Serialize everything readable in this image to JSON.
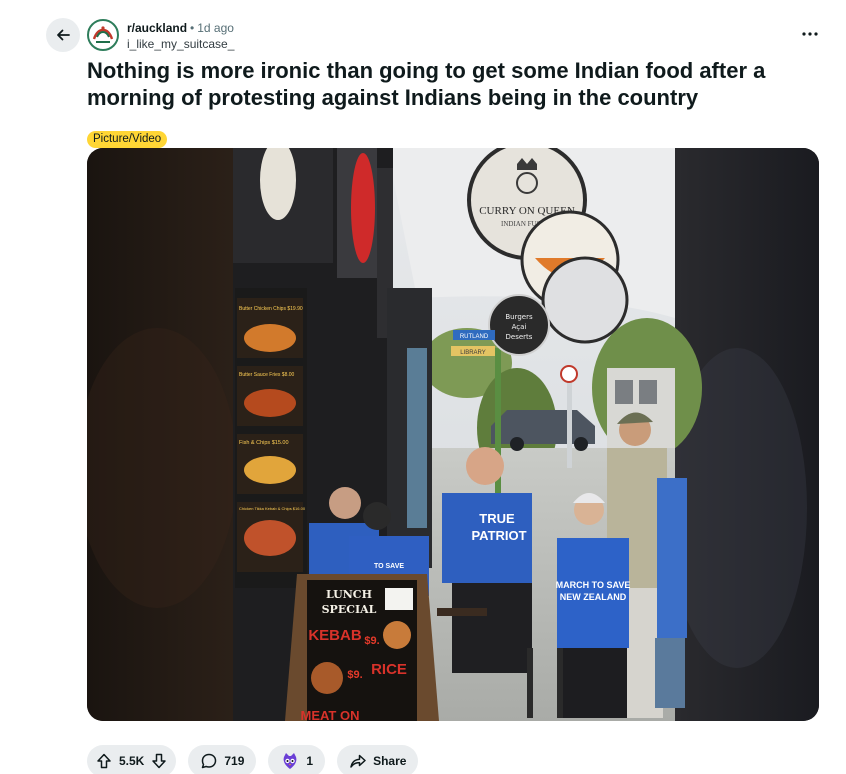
{
  "post": {
    "subreddit": "r/auckland",
    "separator": "•",
    "age": "1d ago",
    "author": "i_like_my_suitcase_",
    "title": "Nothing is more ironic than going to get some Indian food after a morning of protesting against Indians being in the country",
    "flair": "Picture/Video"
  },
  "photo_signs": {
    "curry_line1": "CURRY ON QUEEN",
    "curry_line2": "INDIAN FUSION",
    "menu_board_line1": "Burgers",
    "menu_board_line2": "Açai",
    "menu_board_line3": "Deserts",
    "street_sign": "RUTLAND",
    "library_sign": "LIBRARY",
    "shirt_text1": "TRUE",
    "shirt_text2": "PATRIOT",
    "shirt_text3": "MARCH TO SAVE",
    "shirt_text4": "NEW ZEALAND",
    "lunch1": "LUNCH",
    "lunch2": "SPECIAL",
    "kebab": "KEBAB",
    "kebab_price": "$9.",
    "rice": "RICE",
    "rice_price": "$9.",
    "meat_on": "MEAT ON",
    "menu_item1": "Butter Chicken Chips $19.90",
    "menu_item2": "Butter Sauce Fries $8.00",
    "menu_item3": "Fish & Chips $15.00",
    "menu_item4": "Chicken Tikka Kebab & Chips $16.00"
  },
  "actions": {
    "upvote_count": "5.5K",
    "comment_count": "719",
    "award_count": "1",
    "share_label": "Share"
  },
  "icons": {
    "back": "arrow-left-icon",
    "more": "more-options-icon",
    "upvote": "upvote-icon",
    "downvote": "downvote-icon",
    "comment": "comment-icon",
    "award": "award-icon",
    "share": "share-icon"
  },
  "colors": {
    "flair_bg": "#ffd635",
    "pill_bg": "#eaedef",
    "text": "#0f1a1c",
    "meta": "#576f76"
  }
}
